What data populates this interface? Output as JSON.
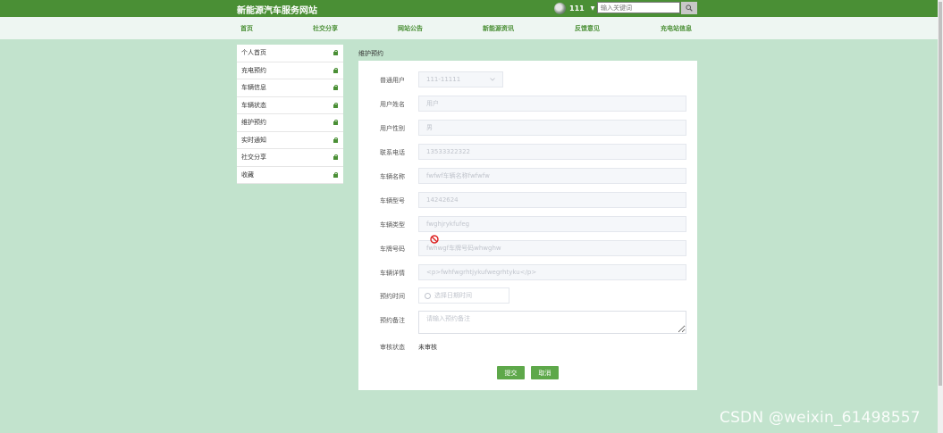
{
  "site": {
    "title": "新能源汽车服务网站"
  },
  "user": {
    "name": "111"
  },
  "search": {
    "placeholder": "输入关键词"
  },
  "nav": [
    "首页",
    "社交分享",
    "网站公告",
    "新能源资讯",
    "反馈意见",
    "充电站信息"
  ],
  "sidebar": [
    "个人首页",
    "充电预约",
    "车辆信息",
    "车辆状态",
    "维护预约",
    "实时通知",
    "社交分享",
    "收藏"
  ],
  "breadcrumb": "维护预约",
  "form": {
    "user_type_label": "普通用户",
    "user_account": "111-11111",
    "name_label": "用户姓名",
    "name_value": "用户",
    "gender_label": "用户性别",
    "gender_value": "男",
    "phone_label": "联系电话",
    "phone_value": "13533322322",
    "car_name_label": "车辆名称",
    "car_name_value": "fwfwf车辆名称fwfwfw",
    "car_model_label": "车辆型号",
    "car_model_value": "14242624",
    "car_type_label": "车辆类型",
    "car_type_value": "fwghjrykfufeg",
    "plate_label": "车牌号码",
    "plate_value": "fwhwgf车牌号码whwghw",
    "detail_label": "车辆详情",
    "detail_value": "<p>fwhfwgrhtjykufwegrhtyku</p>",
    "time_label": "预约时间",
    "time_placeholder": "选择日期时间",
    "remark_label": "预约备注",
    "remark_placeholder": "请输入预约备注",
    "status_label": "审核状态",
    "status_value": "未审核",
    "submit_label": "提交",
    "cancel_label": "取消"
  },
  "watermark": "CSDN @weixin_61498557",
  "colors": {
    "header": "#4a8f35",
    "nav_text": "#4a8f35",
    "background": "#c2e3cd",
    "button": "#5ea84a"
  },
  "icons": [
    "globe-avatar",
    "dropdown-caret",
    "search-icon",
    "lock-icon",
    "chevron-down-icon",
    "clock-icon",
    "no-entry-cursor-icon"
  ]
}
